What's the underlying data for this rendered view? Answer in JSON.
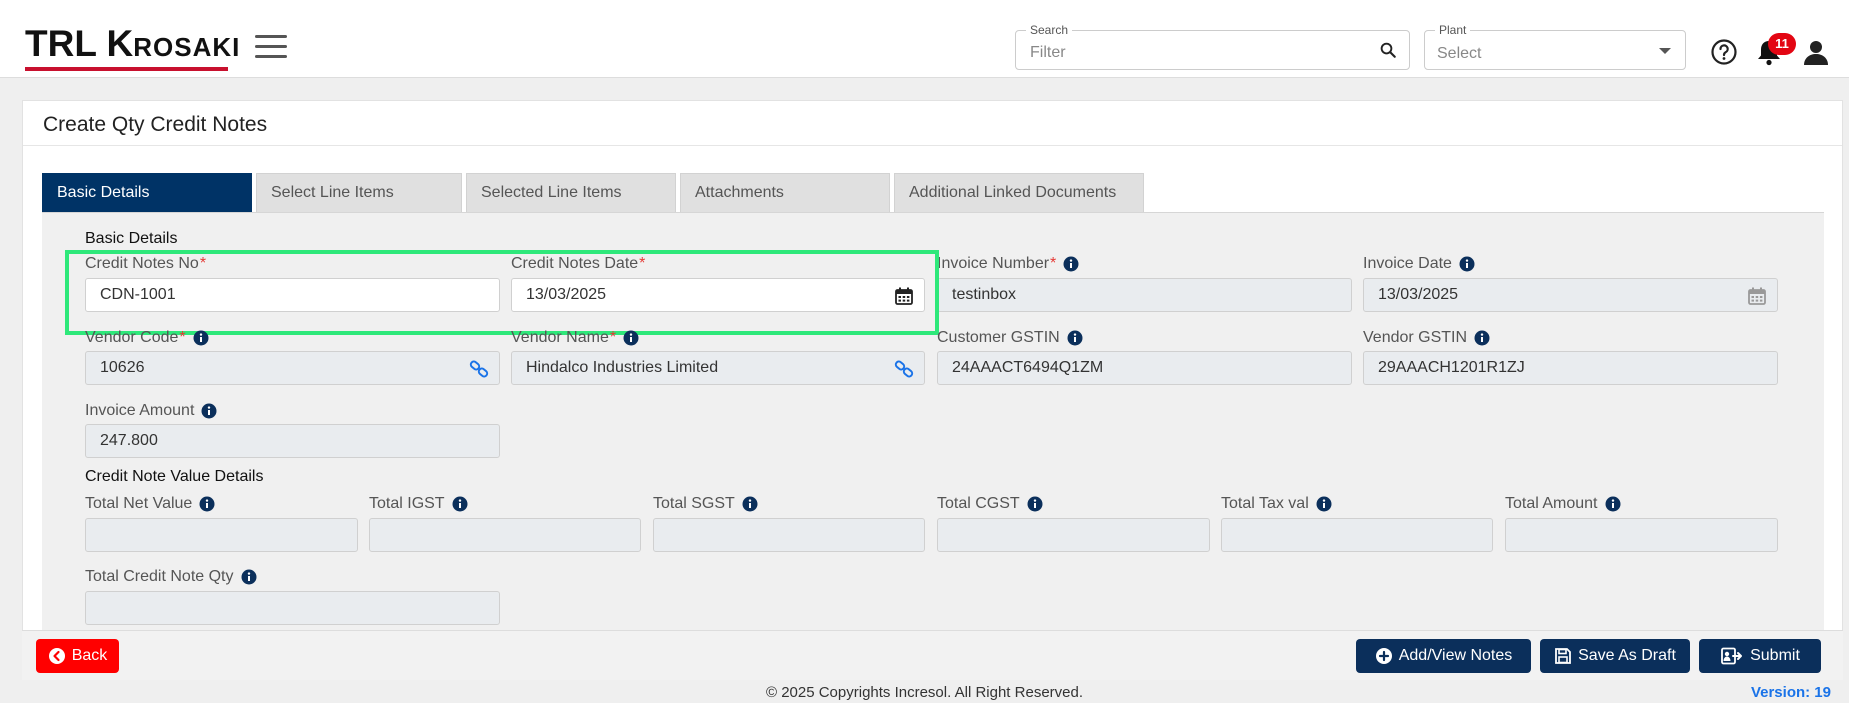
{
  "header": {
    "logo": {
      "part1": "TRL ",
      "part2": "K",
      "part3": "ROSAKI"
    },
    "search": {
      "legend": "Search",
      "placeholder": "Filter"
    },
    "plant": {
      "legend": "Plant",
      "placeholder": "Select"
    },
    "notifications_count": "11"
  },
  "page": {
    "title": "Create Qty Credit Notes"
  },
  "tabs": [
    {
      "label": "Basic Details",
      "active": true
    },
    {
      "label": "Select Line Items"
    },
    {
      "label": "Selected Line Items"
    },
    {
      "label": "Attachments"
    },
    {
      "label": "Additional Linked Documents"
    }
  ],
  "basic_details": {
    "section_title": "Basic Details",
    "credit_notes_no": {
      "label": "Credit Notes No",
      "value": "CDN-1001"
    },
    "credit_notes_date": {
      "label": "Credit Notes Date",
      "value": "13/03/2025"
    },
    "invoice_number": {
      "label": "Invoice Number",
      "value": "testinbox"
    },
    "invoice_date": {
      "label": "Invoice Date",
      "value": "13/03/2025"
    },
    "vendor_code": {
      "label": "Vendor Code",
      "value": "10626"
    },
    "vendor_name": {
      "label": "Vendor Name",
      "value": "Hindalco Industries Limited"
    },
    "customer_gstin": {
      "label": "Customer GSTIN",
      "value": "24AAACT6494Q1ZM"
    },
    "vendor_gstin": {
      "label": "Vendor GSTIN",
      "value": "29AAACH1201R1ZJ"
    },
    "invoice_amount": {
      "label": "Invoice Amount",
      "value": "247.800"
    }
  },
  "value_details": {
    "section_title": "Credit Note Value Details",
    "total_net_value": {
      "label": "Total Net Value",
      "value": ""
    },
    "total_igst": {
      "label": "Total IGST",
      "value": ""
    },
    "total_sgst": {
      "label": "Total SGST",
      "value": ""
    },
    "total_cgst": {
      "label": "Total CGST",
      "value": ""
    },
    "total_tax_val": {
      "label": "Total Tax val",
      "value": ""
    },
    "total_amount": {
      "label": "Total Amount",
      "value": ""
    },
    "total_credit_note_qty": {
      "label": "Total Credit Note Qty",
      "value": ""
    }
  },
  "footer": {
    "back_label": "Back",
    "add_notes_label": "Add/View Notes",
    "save_draft_label": "Save As Draft",
    "submit_label": "Submit",
    "copyright": "© 2025 Copyrights Incresol. All Right Reserved.",
    "version": "Version: 19"
  },
  "colors": {
    "primary": "#0b2f5b",
    "active_tab": "#003366",
    "danger": "#ff0000",
    "highlight": "#2ee87a",
    "link_icon": "#1a73e8"
  }
}
